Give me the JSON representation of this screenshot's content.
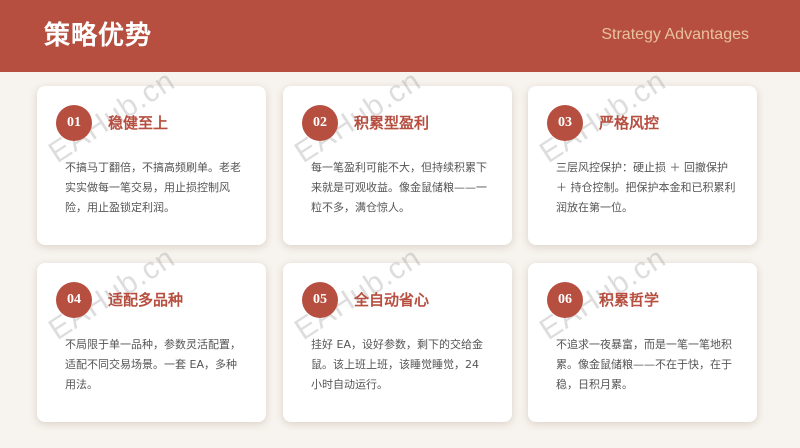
{
  "header": {
    "title": "策略优势",
    "subtitle": "Strategy Advantages"
  },
  "watermark_text": "EAHub.cn",
  "cards": [
    {
      "number": "01",
      "title": "稳健至上",
      "body": "不搞马丁翻倍，不搞高频刷单。老老实实做每一笔交易，用止损控制风险，用止盈锁定利润。"
    },
    {
      "number": "02",
      "title": "积累型盈利",
      "body": "每一笔盈利可能不大，但持续积累下来就是可观收益。像金鼠储粮——一粒不多，满仓惊人。"
    },
    {
      "number": "03",
      "title": "严格风控",
      "body": "三层风控保护：硬止损 ＋ 回撤保护 ＋ 持仓控制。把保护本金和已积累利润放在第一位。"
    },
    {
      "number": "04",
      "title": "适配多品种",
      "body": "不局限于单一品种，参数灵活配置，适配不同交易场景。一套 EA，多种用法。"
    },
    {
      "number": "05",
      "title": "全自动省心",
      "body": "挂好 EA，设好参数，剩下的交给金鼠。该上班上班，该睡觉睡觉，24 小时自动运行。"
    },
    {
      "number": "06",
      "title": "积累哲学",
      "body": "不追求一夜暴富，而是一笔一笔地积累。像金鼠储粮——不在于快，在于稳，日积月累。"
    }
  ],
  "colors": {
    "header_bg": "#b74f40",
    "accent": "#b74f40",
    "subtitle": "#e8c29a",
    "page_bg": "#f7f3ee"
  }
}
